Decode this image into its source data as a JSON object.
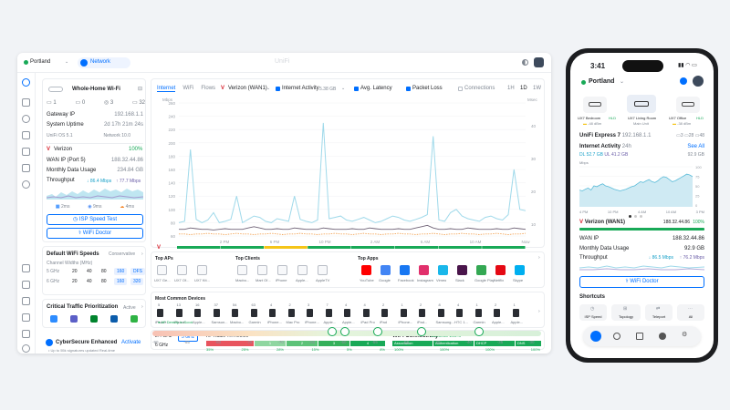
{
  "desktop": {
    "site": "Portland",
    "app_tab": "Network",
    "window_title": "UniFi",
    "wifi_card": {
      "name": "Whole-Home Wi-Fi",
      "counts": [
        "1",
        "0",
        "3",
        "32"
      ],
      "rows": [
        {
          "k": "Gateway IP",
          "v": "192.168.1.1"
        },
        {
          "k": "System Uptime",
          "v": "2d 17h 21m 24s"
        },
        {
          "k": "UniFi OS 5.1",
          "v": "Network 10.0"
        }
      ],
      "isp": "Verizon",
      "isp_pct": "100%",
      "wan_rows": [
        {
          "k": "WAN IP (Port 5)",
          "v": "188.32.44.86"
        },
        {
          "k": "Monthly Data Usage",
          "v": "234.84 GB"
        }
      ],
      "throughput_label": "Throughput",
      "throughput_down": "↓ 86.4 Mbps",
      "throughput_up": "↑ 77.7 Mbps",
      "latency": [
        "2ms",
        "9ms",
        "4ms"
      ],
      "speed_test": "ISP Speed Test",
      "wifi_doctor": "WiFi Doctor"
    },
    "speeds": {
      "title": "Default WiFi Speeds",
      "mode": "Conservative",
      "subtitle": "Channel Widths (MHz)",
      "rows": [
        {
          "band": "5 GHz",
          "vals": [
            "20",
            "40",
            "80",
            "160",
            "DFS"
          ]
        },
        {
          "band": "6 GHz",
          "vals": [
            "20",
            "40",
            "80",
            "160",
            "320"
          ]
        }
      ]
    },
    "traffic": {
      "title": "Critical Traffic Prioritization",
      "status": "Active"
    },
    "cybersecure": {
      "title": "CyberSecure Enhanced",
      "action": "Activate",
      "sub": "Up to 55k signatures updated Real-time"
    },
    "chart_tabs": [
      "Internet",
      "WiFi",
      "Flows"
    ],
    "wan_select": "Verizon (WAN1)",
    "metric_select": "Internet Activity",
    "metric_value": "5.38 GB",
    "toggles": [
      "Avg. Latency",
      "Packet Loss",
      "Connections"
    ],
    "ranges": [
      "1H",
      "1D",
      "1W"
    ],
    "top_aps_title": "Top APs",
    "top_aps": [
      "UX7 Ge...",
      "UX7 Of...",
      "UX7 Kit..."
    ],
    "top_clients_title": "Top Clients",
    "top_clients": [
      "Macbo...",
      "Mart Of...",
      "iPhone",
      "Apple...",
      "AppleTV"
    ],
    "top_apps_title": "Top Apps",
    "top_apps": [
      "YouTube",
      "Google",
      "Facebook",
      "Instagram",
      "Vimeo",
      "Slack",
      "Google Play",
      "Netflix",
      "Skype"
    ],
    "devices_title": "Most Common Devices",
    "devices": [
      {
        "n": "5",
        "l": "iPhone..."
      },
      {
        "n": "13",
        "l": "iPhone..."
      },
      {
        "n": "16",
        "l": "Apple..."
      },
      {
        "n": "37",
        "l": "Samsun..."
      },
      {
        "n": "54",
        "l": "Macbo..."
      },
      {
        "n": "63",
        "l": "Garmin"
      },
      {
        "n": "4",
        "l": "iPhone..."
      },
      {
        "n": "2",
        "l": "Mac Pro"
      },
      {
        "n": "3",
        "l": "iPhone..."
      },
      {
        "n": "7",
        "l": "Apple..."
      },
      {
        "n": "4",
        "l": "Apple..."
      },
      {
        "n": "4",
        "l": "iPad Pro"
      },
      {
        "n": "2",
        "l": "iPad"
      },
      {
        "n": "1",
        "l": "iPhone..."
      },
      {
        "n": "2",
        "l": "iPad..."
      },
      {
        "n": "8",
        "l": "Samsung..."
      },
      {
        "n": "4",
        "l": "HTC 1..."
      },
      {
        "n": "1",
        "l": "Garmin"
      },
      {
        "n": "2",
        "l": "Apple..."
      },
      {
        "n": "1",
        "l": "Apple..."
      }
    ],
    "radio": {
      "bands": [
        "2.4 GHz",
        "5 GHz",
        "6 GHz"
      ],
      "title": "AP Radio TX Retries",
      "seg_vals": [
        "1",
        "2",
        "3",
        "4"
      ],
      "pcts": [
        "35%",
        "25%",
        "28%",
        "15%",
        "5%",
        "8%"
      ]
    },
    "connectivity": {
      "title": "WiFi Connectivity",
      "status": "Success 100%",
      "steps": [
        "Association",
        "Authentication",
        "DHCP",
        "DNS"
      ],
      "pcts": [
        "100%",
        "100%",
        "100%",
        "100%"
      ]
    },
    "density": {
      "label": "AP Density is Good",
      "ticks": [
        "-90",
        "-85",
        "-80",
        "-75",
        "-70",
        "-65",
        "-60",
        "-55",
        "-50",
        "-45",
        "-40",
        "-35",
        "-30"
      ]
    }
  },
  "chart_data": {
    "type": "line",
    "x": [
      "2 PM",
      "6 PM",
      "10 PM",
      "2 AM",
      "6 AM",
      "10 AM",
      "Now"
    ],
    "ylabel_left": "Mbps",
    "ylabel_right": "Msec",
    "y_ticks_left": [
      "260",
      "240",
      "220",
      "200",
      "180",
      "160",
      "140",
      "120",
      "100",
      "80",
      "60"
    ],
    "y_ticks_right": [
      "40",
      "30",
      "20",
      "10"
    ],
    "series": [
      {
        "color": "#9fd9ea",
        "values": [
          80,
          82,
          190,
          85,
          80,
          84,
          95,
          80,
          82,
          85,
          120,
          80,
          85,
          90,
          88,
          82,
          80,
          86,
          84,
          82,
          120,
          85,
          82,
          80,
          84,
          230,
          86,
          88,
          90,
          84,
          82,
          85,
          88,
          84,
          80,
          82,
          86,
          90,
          88,
          84,
          82,
          85,
          88,
          92,
          210,
          84,
          82,
          95,
          100,
          90,
          86,
          84,
          82,
          88,
          90,
          86,
          84,
          92,
          160,
          100,
          98
        ]
      },
      {
        "color": "#6f6276",
        "values": [
          70,
          70,
          72,
          71,
          70,
          70,
          69,
          70,
          71,
          70,
          70,
          70,
          72,
          74,
          72,
          70,
          70,
          71,
          70,
          70,
          72,
          71,
          70,
          70,
          70,
          72,
          71,
          70,
          70,
          70,
          71,
          70,
          70,
          72,
          71,
          70,
          70,
          70,
          71,
          70,
          70,
          72,
          74,
          76,
          72,
          70,
          70,
          71,
          70,
          70,
          72,
          71,
          70,
          70,
          70,
          71,
          70,
          70,
          72,
          71,
          70
        ]
      },
      {
        "color": "#f2a65a",
        "values": [
          63,
          63,
          62,
          63,
          63,
          64,
          63,
          63,
          62,
          63,
          64,
          63,
          63,
          62,
          63,
          63,
          64,
          63,
          62,
          63,
          63,
          64,
          63,
          63,
          62,
          63,
          63,
          64,
          63,
          63,
          62,
          63,
          64,
          63,
          63,
          62,
          63,
          63,
          64,
          63,
          63,
          62,
          63,
          63,
          64,
          63,
          62,
          63,
          63,
          64,
          63,
          63,
          62,
          63,
          63,
          64,
          63,
          62,
          63,
          63,
          64
        ]
      }
    ],
    "status_segments": [
      "#18a957",
      "#18a957",
      "#f5c518",
      "#18a957",
      "#18a957",
      "#18a957",
      "#18a957",
      "#18a957"
    ]
  },
  "phone": {
    "time": "3:41",
    "site": "Portland",
    "devices": [
      {
        "name": "UX7 Bedroom",
        "sub": "-48 dBm",
        "badge": "HLD"
      },
      {
        "name": "UX7 Living Room",
        "sub": "Main Unit",
        "badge": ""
      },
      {
        "name": "UX7 Office",
        "sub": "-38 dBm",
        "badge": "HLD"
      }
    ],
    "gateway_name": "UniFi Express 7",
    "gateway_ip": "192.168.1.1",
    "gateway_counts": [
      "3",
      "28",
      "48"
    ],
    "activity_title": "Internet Activity",
    "activity_range": "24h",
    "see_all": "See All",
    "dl": "DL 52.7 GB",
    "ul": "UL 41.2 GB",
    "total": "92.9 GB",
    "chart_unit": "Mbps",
    "chart_ticks": [
      "100",
      "75",
      "50",
      "25",
      "0"
    ],
    "chart_x": [
      "4 PM",
      "10 PM",
      "4 AM",
      "10 AM",
      "3 PM"
    ],
    "activity_values": [
      40,
      38,
      42,
      45,
      40,
      50,
      48,
      52,
      55,
      50,
      48,
      45,
      42,
      40,
      38,
      40,
      42,
      45,
      48,
      50,
      55,
      60,
      58,
      62,
      65,
      60,
      58,
      62,
      68,
      72,
      70,
      65,
      60,
      62,
      66,
      70,
      74,
      78,
      76,
      72
    ],
    "wan_name": "Verizon (WAN1)",
    "wan_ip_short": "188.32.44.86",
    "wan_pct": "100%",
    "rows": [
      {
        "k": "WAN IP",
        "v": "188.32.44.86"
      },
      {
        "k": "Monthly Data Usage",
        "v": "92.9 GB"
      }
    ],
    "throughput_label": "Throughput",
    "throughput_down": "↓ 86.5 Mbps",
    "throughput_up": "↑ 76.2 Mbps",
    "wifi_doctor": "WiFi Doctor",
    "shortcuts_title": "Shortcuts",
    "shortcuts": [
      "ISP Speed",
      "Topology",
      "Teleport",
      "All"
    ]
  }
}
